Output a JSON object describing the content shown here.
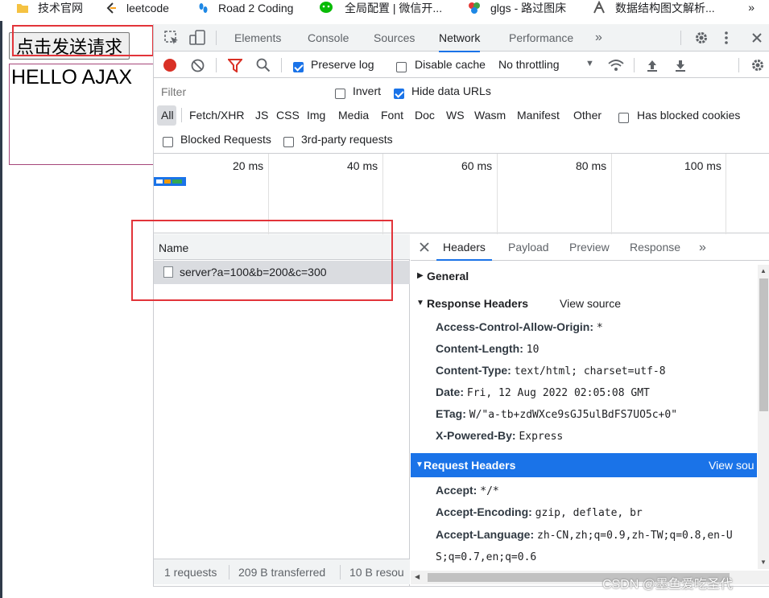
{
  "bookmarks": {
    "items": [
      {
        "label": "技术官网",
        "icon": "folder-icon",
        "color": "#f5c242"
      },
      {
        "label": "leetcode",
        "icon": "leetcode-icon",
        "color": "#f89f1b"
      },
      {
        "label": "Road 2 Coding",
        "icon": "footprint-icon",
        "color": "#1e88e5"
      },
      {
        "label": "全局配置 | 微信开...",
        "icon": "wechat-icon",
        "color": "#09bb07"
      },
      {
        "label": "glgs - 路过图床",
        "icon": "palette-icon",
        "color": "#e53935"
      },
      {
        "label": "数据结构图文解析...",
        "icon": "bookmark-icon",
        "color": "#555555"
      }
    ],
    "more": "»"
  },
  "page": {
    "send_button": "点击发送请求",
    "result_text": "HELLO AJAX"
  },
  "devtools": {
    "tabs": [
      "Elements",
      "Console",
      "Sources",
      "Network",
      "Performance"
    ],
    "active_tab": "Network",
    "more_tabs": "»",
    "toolbar": {
      "preserve_log": "Preserve log",
      "preserve_log_checked": true,
      "disable_cache": "Disable cache",
      "disable_cache_checked": false,
      "throttling": "No throttling"
    },
    "filter": {
      "placeholder": "Filter",
      "invert": "Invert",
      "hide_data_urls": "Hide data URLs",
      "types": [
        "All",
        "Fetch/XHR",
        "JS",
        "CSS",
        "Img",
        "Media",
        "Font",
        "Doc",
        "WS",
        "Wasm",
        "Manifest",
        "Other"
      ],
      "has_blocked_cookies": "Has blocked cookies",
      "blocked_requests": "Blocked Requests",
      "third_party": "3rd-party requests"
    },
    "timeline": {
      "ticks": [
        "20 ms",
        "40 ms",
        "60 ms",
        "80 ms",
        "100 ms"
      ]
    },
    "request_list": {
      "header": "Name",
      "rows": [
        "server?a=100&b=200&c=300"
      ]
    },
    "status": {
      "requests": "1 requests",
      "transferred": "209 B transferred",
      "resources": "10 B resou"
    },
    "details": {
      "tabs": [
        "Headers",
        "Payload",
        "Preview",
        "Response"
      ],
      "active_tab": "Headers",
      "more": "»",
      "general": "General",
      "response_headers_title": "Response Headers",
      "view_source": "View source",
      "response_headers": [
        {
          "key": "Access-Control-Allow-Origin:",
          "value": "*"
        },
        {
          "key": "Content-Length:",
          "value": "10"
        },
        {
          "key": "Content-Type:",
          "value": "text/html; charset=utf-8"
        },
        {
          "key": "Date:",
          "value": "Fri, 12 Aug 2022 02:05:08 GMT"
        },
        {
          "key": "ETag:",
          "value": "W/\"a-tb+zdWXce9sGJ5ulBdFS7UO5c+0\""
        },
        {
          "key": "X-Powered-By:",
          "value": "Express"
        }
      ],
      "request_headers_title": "Request Headers",
      "request_view_source": "View sou",
      "request_headers": [
        {
          "key": "Accept:",
          "value": "*/*"
        },
        {
          "key": "Accept-Encoding:",
          "value": "gzip, deflate, br"
        },
        {
          "key": "Accept-Language:",
          "value": "zh-CN,zh;q=0.9,zh-TW;q=0.8,en-U"
        }
      ],
      "request_headers_wrap": "S;q=0.7,en;q=0.6"
    }
  },
  "watermark": "CSDN @墨鱼爱吃圣代",
  "colors": {
    "accent": "#1a73e8",
    "highlight_frame": "#e2343a",
    "record": "#d93025"
  }
}
